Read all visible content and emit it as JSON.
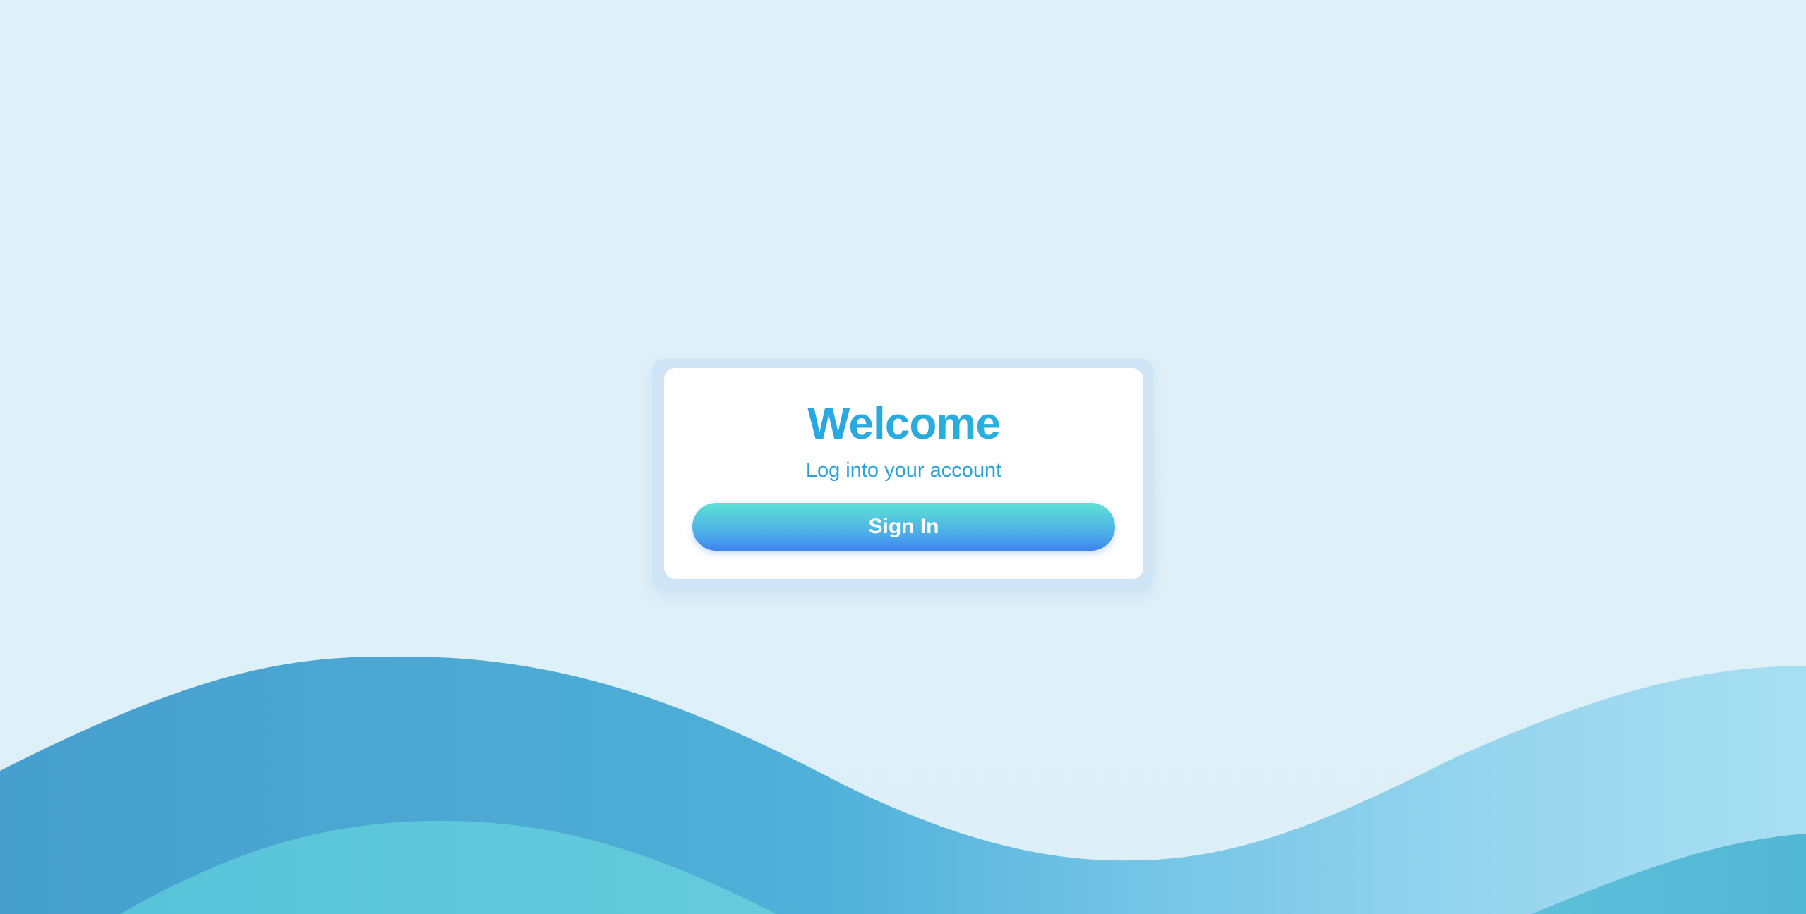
{
  "login": {
    "title": "Welcome",
    "subtitle": "Log into your account",
    "sign_in_label": "Sign In"
  },
  "colors": {
    "background": "#dff0f9",
    "accent": "#2aa7e0",
    "button_top": "#5ee2d5",
    "button_bottom": "#3f82ee",
    "wave_dark": "#46a6d4",
    "wave_light": "#5fc7d9"
  }
}
